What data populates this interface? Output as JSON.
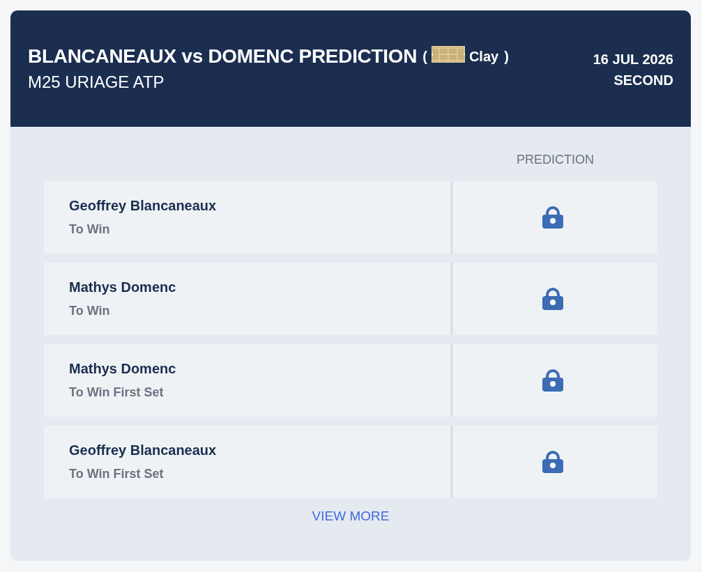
{
  "header": {
    "title": "BLANCANEAUX vs DOMENC PREDICTION",
    "surface": {
      "open": "(",
      "label": "Clay",
      "close": ")"
    },
    "tournament": "M25 URIAGE ATP",
    "date": "16 JUL 2026",
    "round": "SECOND"
  },
  "table": {
    "column_header": "PREDICTION",
    "rows": [
      {
        "player": "Geoffrey Blancaneaux",
        "market": "To Win",
        "locked": true
      },
      {
        "player": "Mathys Domenc",
        "market": "To Win",
        "locked": true
      },
      {
        "player": "Mathys Domenc",
        "market": "To Win First Set",
        "locked": true
      },
      {
        "player": "Geoffrey Blancaneaux",
        "market": "To Win First Set",
        "locked": true
      }
    ]
  },
  "view_more": "VIEW MORE"
}
